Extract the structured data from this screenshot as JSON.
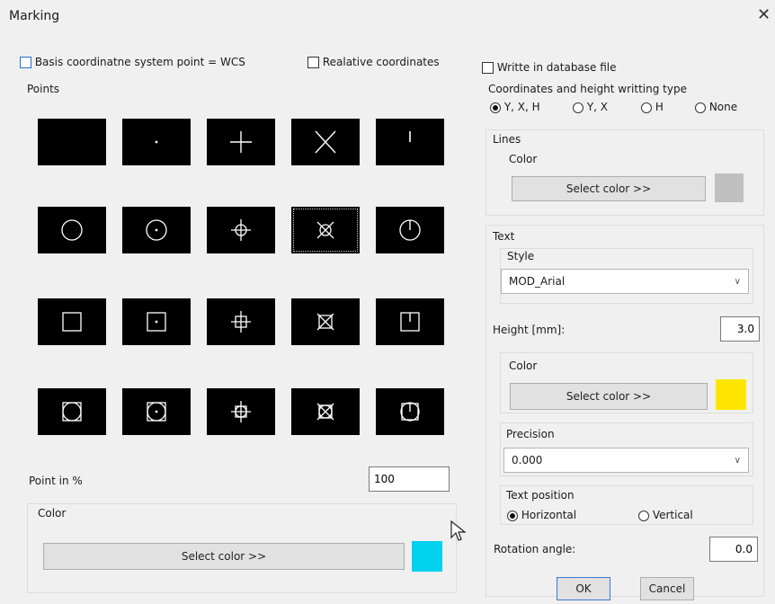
{
  "window": {
    "title": "Marking",
    "close_glyph": "✕"
  },
  "options": {
    "basis_wcs_label": "Basis coordinatne system point = WCS",
    "basis_wcs_checked": false,
    "relative_label": "Realative coordinates",
    "relative_checked": false,
    "write_db_label": "Writte in database file",
    "write_db_checked": false
  },
  "points": {
    "label": "Points",
    "tiles": [
      [
        "blank-point-icon",
        "dot-point-icon",
        "plus-point-icon",
        "cross-point-icon",
        "tick-point-icon"
      ],
      [
        "circle-point-icon",
        "circle-dot-point-icon",
        "circle-plus-point-icon",
        "circle-cross-point-icon",
        "circle-tick-point-icon"
      ],
      [
        "square-point-icon",
        "square-dot-point-icon",
        "square-plus-point-icon",
        "square-cross-point-icon",
        "square-tick-point-icon"
      ],
      [
        "circle-square-point-icon",
        "circle-square-dot-point-icon",
        "circle-square-plus-point-icon",
        "circle-square-cross-point-icon",
        "circle-square-tick-point-icon"
      ]
    ],
    "selected_tile": "circle-cross-point-icon",
    "percent_label": "Point in %",
    "percent_value": "100",
    "color_label": "Color",
    "select_color_label": "Select color >>",
    "color": "#00d2ee"
  },
  "coord_type": {
    "label": "Coordinates and height writting type",
    "options": [
      "Y, X, H",
      "Y, X",
      "H",
      "None"
    ],
    "selected": "Y, X, H"
  },
  "lines": {
    "label": "Lines",
    "color_label": "Color",
    "select_color_label": "Select color >>",
    "color": "#bfbfbf"
  },
  "text": {
    "label": "Text",
    "style_label": "Style",
    "style_value": "MOD_Arial",
    "height_label": "Height [mm]:",
    "height_value": "3.0",
    "color_label": "Color",
    "select_color_label": "Select color >>",
    "color": "#ffe600",
    "precision_label": "Precision",
    "precision_value": "0.000",
    "position_label": "Text position",
    "position_options": [
      "Horizontal",
      "Vertical"
    ],
    "position_selected": "Horizontal",
    "rotation_label": "Rotation angle:",
    "rotation_value": "0.0"
  },
  "footer": {
    "ok_label": "OK",
    "cancel_label": "Cancel"
  }
}
